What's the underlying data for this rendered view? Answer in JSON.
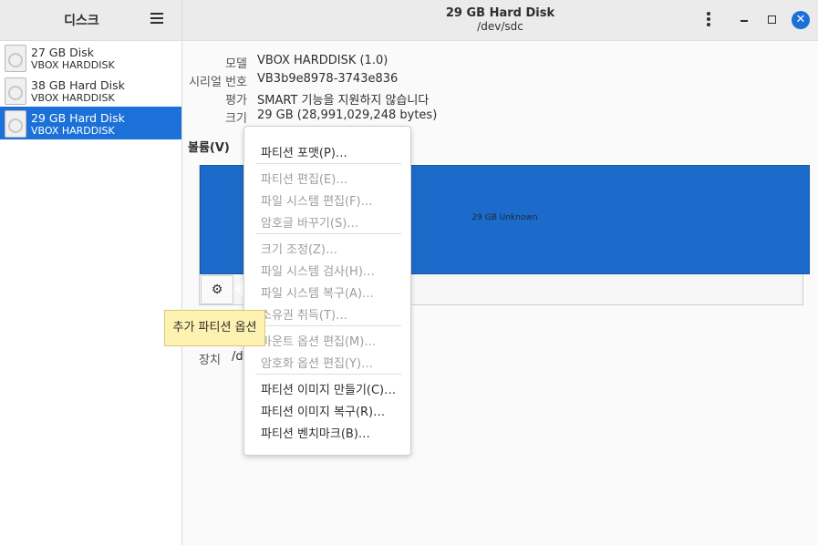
{
  "sidebar": {
    "title": "디스크",
    "disks": [
      {
        "name": "27 GB Disk",
        "model": "VBOX HARDDISK",
        "selected": false
      },
      {
        "name": "38 GB Hard Disk",
        "model": "VBOX HARDDISK",
        "selected": false
      },
      {
        "name": "29 GB Hard Disk",
        "model": "VBOX HARDDISK",
        "selected": true
      }
    ]
  },
  "header": {
    "title": "29 GB Hard Disk",
    "subtitle": "/dev/sdc"
  },
  "info": {
    "model_label": "모델",
    "model_value": "VBOX HARDDISK (1.0)",
    "serial_label": "시리얼 번호",
    "serial_value": "VB3b9e8978-3743e836",
    "rating_label": "평가",
    "rating_value": "SMART 기능을 지원하지 않습니다",
    "size_label": "크기",
    "size_value": "29 GB (28,991,029,248 bytes)"
  },
  "volumes": {
    "label": "볼륨(V)",
    "partition_text": "29 GB Unknown",
    "device_label": "장치",
    "device_value": "/d"
  },
  "menu": {
    "items": [
      {
        "label": "파티션 포맷(P)…",
        "enabled": true
      },
      {
        "label": "파티션 편집(E)…",
        "enabled": false
      },
      {
        "label": "파일 시스템 편집(F)…",
        "enabled": false
      },
      {
        "label": "암호글 바꾸기(S)…",
        "enabled": false
      },
      {
        "label": "크기 조정(Z)…",
        "enabled": false
      },
      {
        "label": "파일 시스템 검사(H)…",
        "enabled": false
      },
      {
        "label": "파일 시스템 복구(A)…",
        "enabled": false
      },
      {
        "label": "소유권 취득(T)…",
        "enabled": false
      },
      {
        "label": "마운트 옵션 편집(M)…",
        "enabled": false
      },
      {
        "label": "암호화 옵션 편집(Y)…",
        "enabled": false
      },
      {
        "label": "파티션 이미지 만들기(C)…",
        "enabled": true
      },
      {
        "label": "파티션 이미지 복구(R)…",
        "enabled": true
      },
      {
        "label": "파티션 벤치마크(B)…",
        "enabled": true
      }
    ]
  },
  "tooltip": "추가 파티션 옵션",
  "colors": {
    "accent": "#1c71d8",
    "partition": "#1c6ac9",
    "tooltip_bg": "#fdf2b1"
  }
}
